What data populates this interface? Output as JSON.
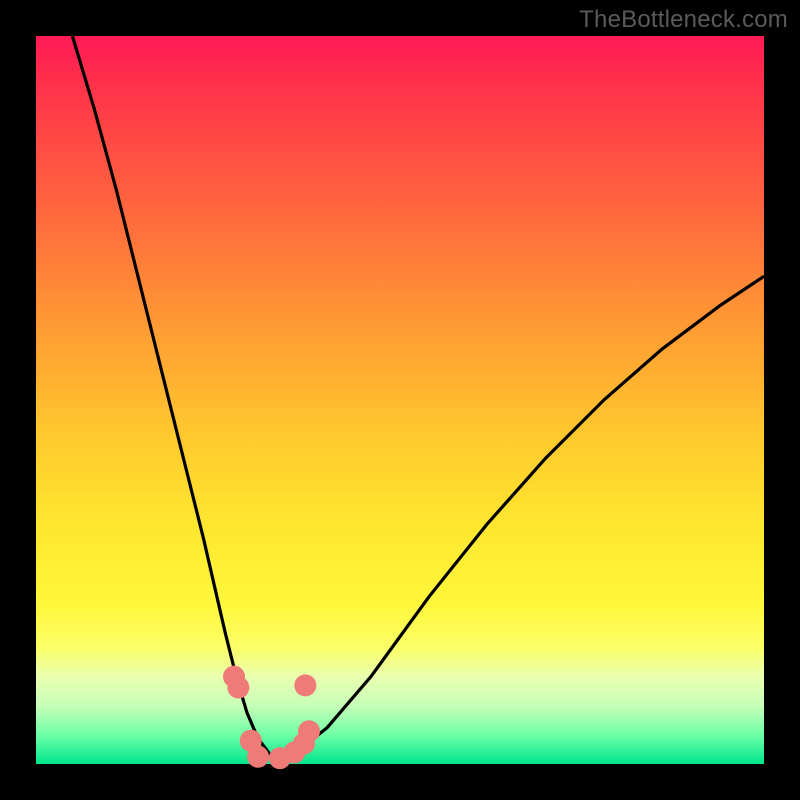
{
  "watermark": "TheBottleneck.com",
  "chart_data": {
    "type": "line",
    "title": "",
    "xlabel": "",
    "ylabel": "",
    "xlim": [
      0,
      100
    ],
    "ylim": [
      0,
      100
    ],
    "grid": false,
    "legend": false,
    "series": [
      {
        "name": "bottleneck-curve",
        "x": [
          5,
          8,
          11,
          14,
          17,
          20,
          23,
          26,
          27.5,
          29,
          30.5,
          32,
          33,
          34,
          36,
          40,
          46,
          54,
          62,
          70,
          78,
          86,
          94,
          100
        ],
        "y": [
          100,
          90,
          79,
          67,
          55,
          43,
          31,
          18,
          12,
          7,
          3.5,
          1.5,
          0.7,
          0.7,
          1.8,
          5,
          12,
          23,
          33,
          42,
          50,
          57,
          63,
          67
        ]
      }
    ],
    "markers": {
      "name": "annotated-points",
      "color": "#ee7b78",
      "radius_px": 11,
      "points": [
        {
          "x": 27.2,
          "y": 12.0
        },
        {
          "x": 27.8,
          "y": 10.5
        },
        {
          "x": 29.5,
          "y": 3.2
        },
        {
          "x": 30.5,
          "y": 1.0
        },
        {
          "x": 33.5,
          "y": 0.8
        },
        {
          "x": 35.5,
          "y": 1.6
        },
        {
          "x": 36.8,
          "y": 2.8
        },
        {
          "x": 37.5,
          "y": 4.5
        },
        {
          "x": 37.0,
          "y": 10.8
        }
      ]
    },
    "background_gradient": {
      "orientation": "vertical",
      "stops": [
        {
          "pos": 0.0,
          "color": "#ff1a53"
        },
        {
          "pos": 0.4,
          "color": "#ff9b33"
        },
        {
          "pos": 0.78,
          "color": "#fff73a"
        },
        {
          "pos": 1.0,
          "color": "#00e58c"
        }
      ]
    }
  }
}
